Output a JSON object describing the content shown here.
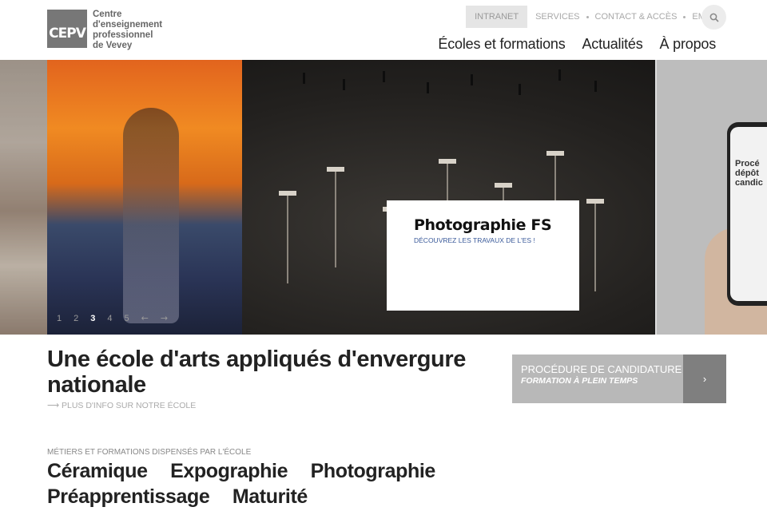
{
  "header": {
    "logo": {
      "mark": "CEPV",
      "lines": [
        "Centre",
        "d'enseignement",
        "professionnel",
        "de Vevey"
      ]
    },
    "topbar": {
      "intranet": "INTRANET",
      "links": [
        "SERVICES",
        "CONTACT & ACCÈS",
        "EMPLOI"
      ]
    },
    "nav": [
      "Écoles et formations",
      "Actualités",
      "À propos"
    ]
  },
  "hero": {
    "caption_title": "Photographie FS",
    "caption_sub": "DÉCOUVREZ LES TRAVAUX DE L'ES !",
    "phone_text": "Procé dépôt candic",
    "pager": [
      "1",
      "2",
      "3",
      "4",
      "5"
    ],
    "active_slide": 3
  },
  "intro": {
    "headline": "Une école d'arts appliqués d'envergure nationale",
    "more": "⟶ PLUS D'INFO SUR NOTRE ÉCOLE"
  },
  "cta": {
    "title": "PROCÉDURE DE CANDIDATURE",
    "sub": "FORMATION À PLEIN TEMPS",
    "arrow": "›"
  },
  "trades": {
    "label": "MÉTIERS ET FORMATIONS DISPENSÉS PAR L'ÉCOLE",
    "items": [
      "Céramique",
      "Expographie",
      "Photographie",
      "Préapprentissage",
      "Maturité"
    ]
  }
}
